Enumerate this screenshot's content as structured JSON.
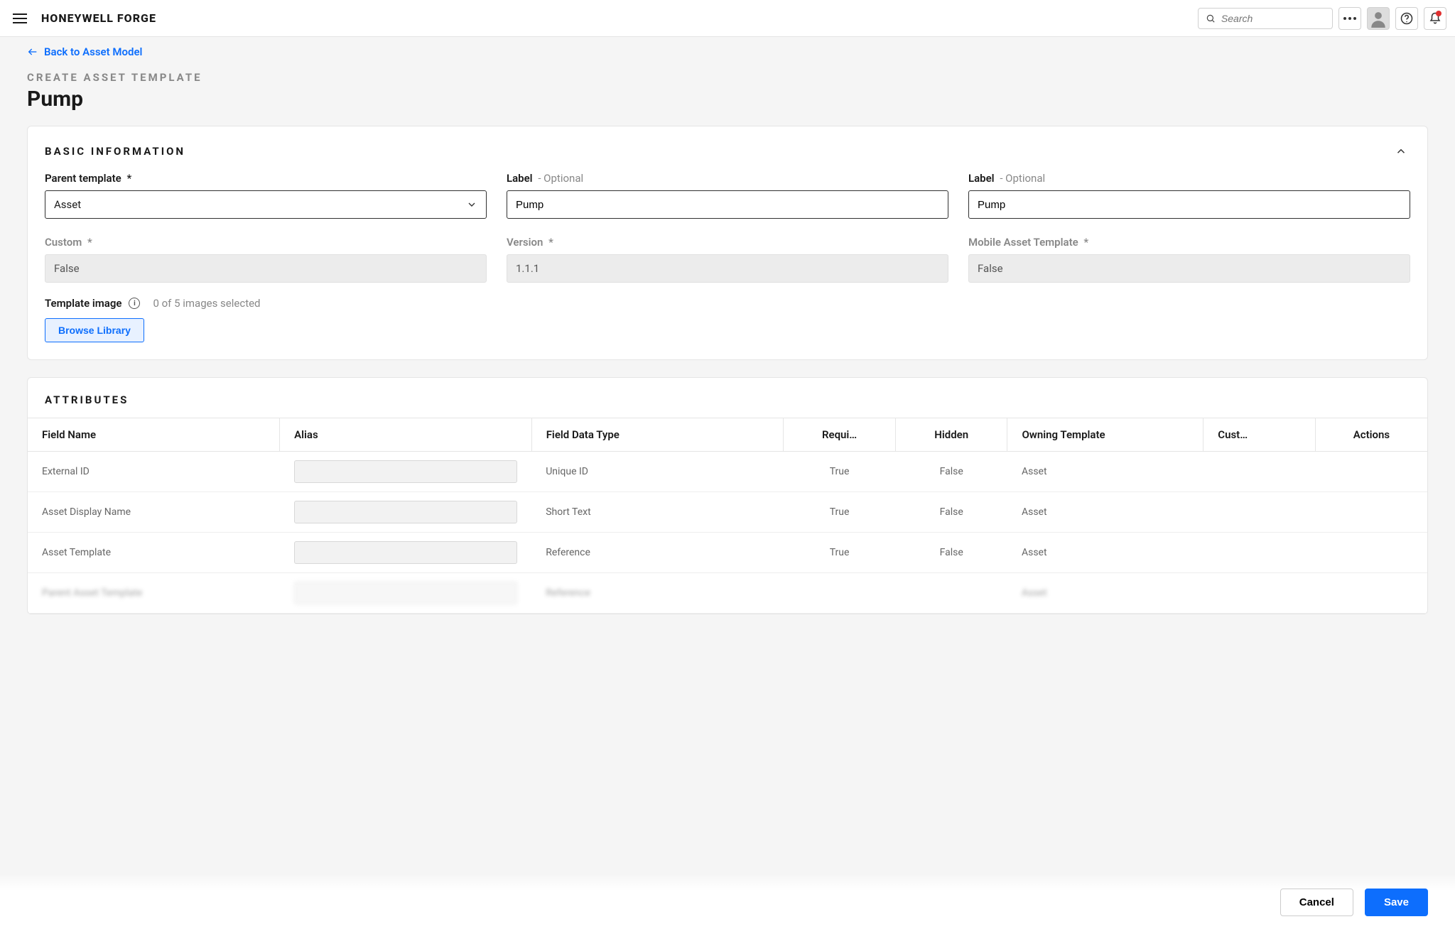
{
  "brand": "HONEYWELL FORGE",
  "search": {
    "placeholder": "Search"
  },
  "backlink": "Back to Asset Model",
  "eyebrow": "CREATE ASSET TEMPLATE",
  "title": "Pump",
  "sections": {
    "basic": {
      "title": "BASIC INFORMATION",
      "parent_template": {
        "label": "Parent template",
        "required": "*",
        "value": "Asset"
      },
      "label1": {
        "label": "Label",
        "hint": "- Optional",
        "value": "Pump"
      },
      "label2": {
        "label": "Label",
        "hint": "- Optional",
        "value": "Pump"
      },
      "custom": {
        "label": "Custom",
        "required": "*",
        "value": "False"
      },
      "version": {
        "label": "Version",
        "required": "*",
        "value": "1.1.1"
      },
      "mobile": {
        "label": "Mobile Asset Template",
        "required": "*",
        "value": "False"
      },
      "image": {
        "label": "Template image",
        "status": "0 of 5 images selected",
        "browse": "Browse Library"
      }
    },
    "attributes": {
      "title": "ATTRIBUTES",
      "columns": {
        "field_name": "Field Name",
        "alias": "Alias",
        "field_data_type": "Field Data Type",
        "required": "Requi…",
        "hidden": "Hidden",
        "owning_template": "Owning Template",
        "custom": "Cust…",
        "actions": "Actions"
      },
      "rows": [
        {
          "field_name": "External ID",
          "alias": "",
          "data_type": "Unique ID",
          "required": "True",
          "hidden": "False",
          "owning": "Asset"
        },
        {
          "field_name": "Asset Display Name",
          "alias": "",
          "data_type": "Short Text",
          "required": "True",
          "hidden": "False",
          "owning": "Asset"
        },
        {
          "field_name": "Asset Template",
          "alias": "",
          "data_type": "Reference",
          "required": "True",
          "hidden": "False",
          "owning": "Asset"
        },
        {
          "field_name": "Parent Asset Template",
          "alias": "",
          "data_type": "Reference",
          "required": "",
          "hidden": "",
          "owning": "Asset"
        }
      ]
    }
  },
  "footer": {
    "cancel": "Cancel",
    "save": "Save"
  }
}
